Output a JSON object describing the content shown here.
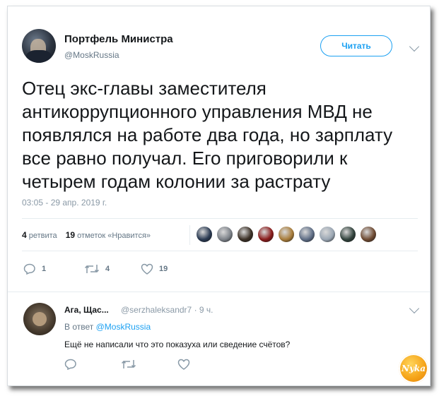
{
  "tweet": {
    "author_name": "Портфель Министра",
    "author_handle": "@MoskRussia",
    "follow_label": "Читать",
    "text": "Отец экс-главы заместителя антикоррупционного управления МВД не появлялся на работе два года, но зарплату все равно получал. Его приговорили к четырем годам колонии за растрату",
    "timestamp": "03:05 - 29 апр. 2019 г.",
    "retweets_count": "4",
    "retweets_label": "ретвита",
    "likes_count": "19",
    "likes_label": "отметок «Нравится»",
    "likers_avatar_colors": [
      "#2a3a52",
      "#7d8289",
      "#3b3026",
      "#8a1c1c",
      "#a87c3a",
      "#5f6e86",
      "#9aa6b3",
      "#31423c",
      "#6e4a32"
    ],
    "actions": {
      "reply_count": "1",
      "retweet_count": "4",
      "like_count": "19"
    }
  },
  "reply": {
    "author_name": "Ага, Щас...",
    "author_handle": "@serzhaleksandr7",
    "time": "9 ч.",
    "reply_to_prefix": "В ответ",
    "reply_to_handle": "@MoskRussia",
    "text": "Ещё не написали что это показуха или сведение счётов?"
  },
  "watermark": {
    "text": "Nyka"
  },
  "colors": {
    "accent": "#1da1f2",
    "text_primary": "#14171a",
    "text_secondary": "#657786",
    "divider": "#e6ecf0"
  }
}
